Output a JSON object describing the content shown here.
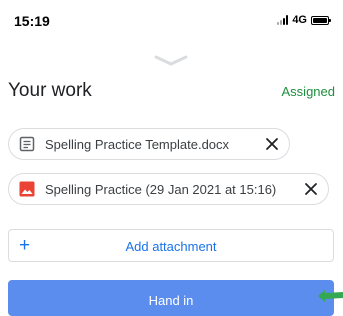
{
  "status_bar": {
    "time": "15:19",
    "network": "4G"
  },
  "header": {
    "title": "Your work",
    "status": "Assigned"
  },
  "attachments": [
    {
      "label": "Spelling Practice Template.docx",
      "icon": "document-icon",
      "icon_color": "#5f6368"
    },
    {
      "label": "Spelling Practice (29 Jan 2021 at 15:16)",
      "icon": "image-icon",
      "icon_color": "#ea4335"
    }
  ],
  "add_attachment": {
    "label": "Add attachment",
    "icon": "plus-icon"
  },
  "hand_in": {
    "label": "Hand in"
  },
  "colors": {
    "accent": "#1a73e8",
    "assigned": "#1e8e3e",
    "button": "#5b8def",
    "arrow": "#34a853"
  }
}
